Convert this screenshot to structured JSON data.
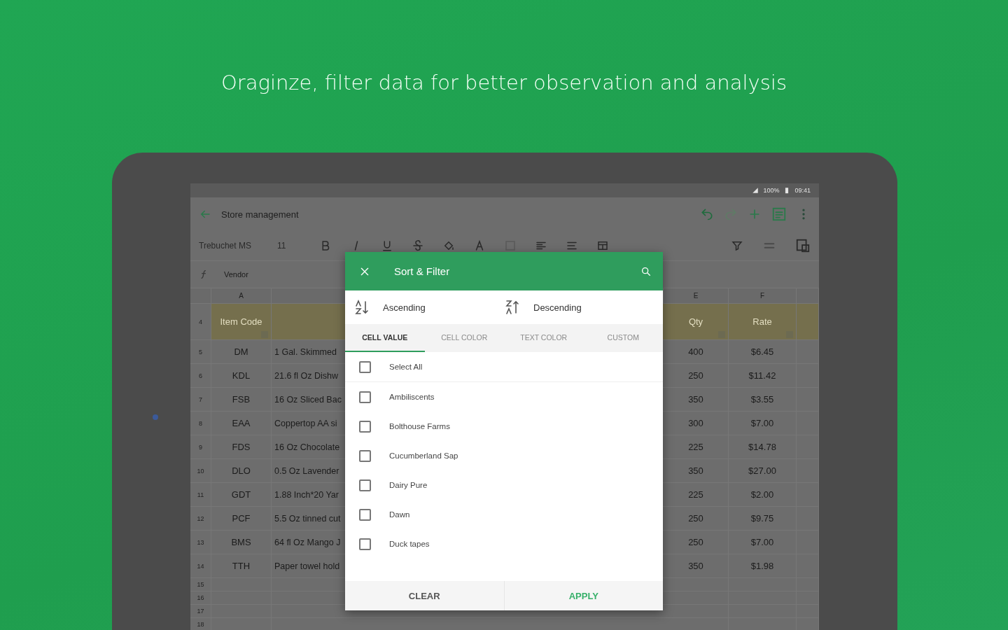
{
  "headline": "Oraginze, filter data for better observation and analysis",
  "status_bar": {
    "battery": "100%",
    "time": "09:41"
  },
  "toolbar": {
    "title": "Store management"
  },
  "format_bar": {
    "font": "Trebuchet MS",
    "size": "11"
  },
  "formula_bar": {
    "value": "Vendor"
  },
  "sheet": {
    "column_letters": [
      "A",
      "E",
      "F"
    ],
    "header_row": {
      "number": "4",
      "cells": [
        "Item Code",
        "Qty",
        "Rate"
      ]
    },
    "rows": [
      {
        "number": "5",
        "code": "DM",
        "description": "1 Gal. Skimmed",
        "qty": "400",
        "rate": "$6.45"
      },
      {
        "number": "6",
        "code": "KDL",
        "description": "21.6 fl Oz Dishw",
        "qty": "250",
        "rate": "$11.42"
      },
      {
        "number": "7",
        "code": "FSB",
        "description": "16 Oz Sliced Bac",
        "qty": "350",
        "rate": "$3.55"
      },
      {
        "number": "8",
        "code": "EAA",
        "description": "Coppertop AA si",
        "qty": "300",
        "rate": "$7.00"
      },
      {
        "number": "9",
        "code": "FDS",
        "description": "16 Oz Chocolate",
        "qty": "225",
        "rate": "$14.78"
      },
      {
        "number": "10",
        "code": "DLO",
        "description": "0.5 Oz Lavender",
        "qty": "350",
        "rate": "$27.00"
      },
      {
        "number": "11",
        "code": "GDT",
        "description": "1.88 Inch*20 Yar",
        "qty": "225",
        "rate": "$2.00"
      },
      {
        "number": "12",
        "code": "PCF",
        "description": "5.5 Oz tinned cut",
        "qty": "250",
        "rate": "$9.75"
      },
      {
        "number": "13",
        "code": "BMS",
        "description": "64 fl Oz Mango J",
        "qty": "250",
        "rate": "$7.00"
      },
      {
        "number": "14",
        "code": "TTH",
        "description": "Paper towel hold",
        "qty": "350",
        "rate": "$1.98"
      }
    ],
    "empty_rows": [
      "15",
      "16",
      "17",
      "18"
    ]
  },
  "dialog": {
    "title": "Sort & Filter",
    "sort": [
      "Ascending",
      "Descending"
    ],
    "tabs": [
      {
        "label": "CELL VALUE",
        "selected": true
      },
      {
        "label": "CELL COLOR",
        "selected": false
      },
      {
        "label": "TEXT COLOR",
        "selected": false
      },
      {
        "label": "CUSTOM",
        "selected": false
      }
    ],
    "select_all": {
      "label": "Select All",
      "checked": false
    },
    "items": [
      {
        "label": "Ambiliscents",
        "checked": false
      },
      {
        "label": "Bolthouse Farms",
        "checked": false
      },
      {
        "label": "Cucumberland Sap",
        "checked": false
      },
      {
        "label": "Dairy Pure",
        "checked": false
      },
      {
        "label": "Dawn",
        "checked": false
      },
      {
        "label": "Duck tapes",
        "checked": false
      }
    ],
    "buttons": [
      {
        "label": "CLEAR",
        "kind": "plain"
      },
      {
        "label": "APPLY",
        "kind": "primary"
      }
    ]
  }
}
